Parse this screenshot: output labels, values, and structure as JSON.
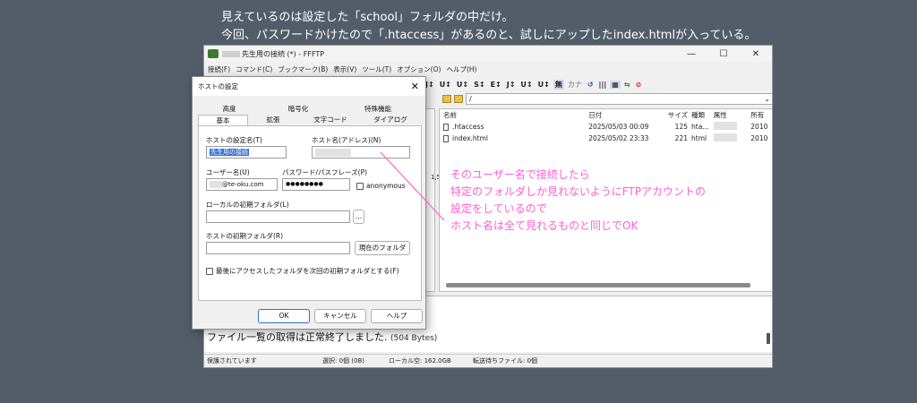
{
  "annotation": {
    "line1": "見えているのは設定した「school」フォルダの中だけ。",
    "line2": "今回、パスワードかけたので「.htaccess」があるのと、試しにアップしたindex.htmlが入っている。"
  },
  "window": {
    "title": "先生用の接続 (*) - FFFTP",
    "controls": [
      "—",
      "☐",
      "✕"
    ],
    "menu": [
      "接続(F)",
      "コマンド(C)",
      "ブックマーク(B)",
      "表示(V)",
      "ツール(T)",
      "オプション(O)",
      "ヘルプ(H)"
    ],
    "toolbar": [
      "J↕",
      "U↕",
      "U↕",
      "S↕",
      "E↕",
      "J↕",
      "U↕",
      "U↕",
      "無",
      "カナ",
      "↺",
      "|||",
      "▦",
      "⇆",
      "⊘"
    ],
    "remote_path": "/",
    "file_columns": [
      "名前",
      "日付",
      "サイズ",
      "種類",
      "属性",
      "所有"
    ],
    "files": [
      {
        "name": ".htaccess",
        "date": "2025/05/03 00:09",
        "size": "125",
        "type": "hta...",
        "owner": "2010"
      },
      {
        "name": "index.html",
        "date": "2025/05/02 23:33",
        "size": "221",
        "type": "html",
        "owner": "2010"
      }
    ],
    "left_hint": "1,5",
    "log_message": "ファイル一覧の取得は正常終了しました.",
    "log_bytes": "(504 Bytes)",
    "status": {
      "protect": "保護されています",
      "selected": "選択: 0個 (0B)",
      "local_free": "ローカル空: 162.0GB",
      "transfer": "転送待ちファイル: 0個"
    }
  },
  "dialog": {
    "title": "ホストの設定",
    "tabs_row1": [
      "高度",
      "暗号化",
      "特殊機能"
    ],
    "tabs_row2": [
      "基本",
      "拡張",
      "文字コード",
      "ダイアログ"
    ],
    "setting_name_label": "ホストの設定名(T)",
    "setting_name_value": "先生用の接続",
    "host_label": "ホスト名(アドレス)(N)",
    "user_label": "ユーザー名(U)",
    "user_value": "@te-oku.com",
    "pass_label": "パスワード/パスフレーズ(P)",
    "pass_value": "●●●●●●●●",
    "anonymous_label": "anonymous",
    "local_folder_label": "ローカルの初期フォルダ(L)",
    "browse_label": "...",
    "remote_folder_label": "ホストの初期フォルダ(R)",
    "current_folder_label": "現在のフォルダ",
    "last_folder_label": "最後にアクセスしたフォルダを次回の初期フォルダとする(F)",
    "ok": "OK",
    "cancel": "キャンセル",
    "help": "ヘルプ"
  },
  "note": {
    "line1": "そのユーザー名で接続したら",
    "line2": "特定のフォルダしか見れないようにFTPアカウントの",
    "line3": "設定をしているので",
    "line4": "ホスト名は全て見れるものと同じでOK"
  },
  "colors": {
    "background": "#535d6a",
    "annotation": "#ff5fd1",
    "selection": "#2f6fd6"
  }
}
